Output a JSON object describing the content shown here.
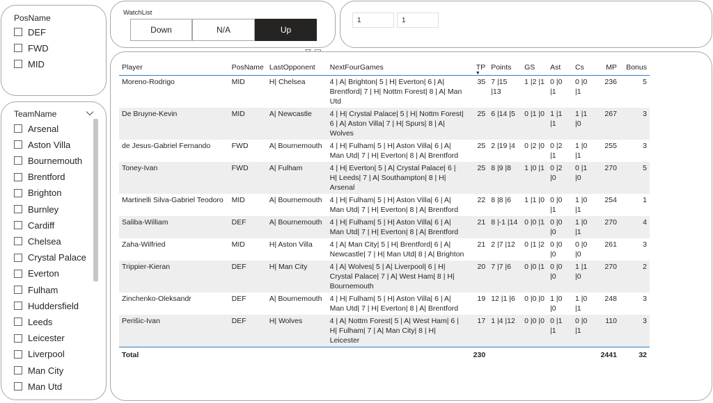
{
  "pos_slicer": {
    "title": "PosName",
    "items": [
      "DEF",
      "FWD",
      "MID"
    ]
  },
  "team_slicer": {
    "title": "TeamName",
    "items": [
      "Arsenal",
      "Aston Villa",
      "Bournemouth",
      "Brentford",
      "Brighton",
      "Burnley",
      "Cardiff",
      "Chelsea",
      "Crystal Palace",
      "Everton",
      "Fulham",
      "Huddersfield",
      "Leeds",
      "Leicester",
      "Liverpool",
      "Man City",
      "Man Utd"
    ]
  },
  "watchlist": {
    "title": "WatchList",
    "buttons": [
      "Down",
      "N/A",
      "Up"
    ],
    "selected": "Up"
  },
  "range_inputs": [
    "1",
    "1"
  ],
  "table": {
    "columns": [
      "Player",
      "PosName",
      "LastOpponent",
      "NextFourGames",
      "TP",
      "Points",
      "GS",
      "Ast",
      "Cs",
      "MP",
      "Bonus"
    ],
    "sorted_column": "TP",
    "rows": [
      [
        "Moreno-Rodrigo",
        "MID",
        "H| Chelsea",
        "4 | A| Brighton| 5 | H| Everton| 6 | A| Brentford| 7 | H| Nottm Forest| 8 | A| Man Utd",
        "35",
        "7 |15 |13",
        "1 |2 |1",
        "0 |0 |1",
        "0 |0 |1",
        "236",
        "5"
      ],
      [
        "De Bruyne-Kevin",
        "MID",
        "A| Newcastle",
        "4 | H| Crystal Palace| 5 | H| Nottm Forest| 6 | A| Aston Villa| 7 | H| Spurs| 8 | A| Wolves",
        "25",
        "6 |14 |5",
        "0 |1 |0",
        "1 |1 |1",
        "1 |1 |0",
        "267",
        "3"
      ],
      [
        "de Jesus-Gabriel Fernando",
        "FWD",
        "A| Bournemouth",
        "4 | H| Fulham| 5 | H| Aston Villa| 6 | A| Man Utd| 7 | H| Everton| 8 | A| Brentford",
        "25",
        "2 |19 |4",
        "0 |2 |0",
        "0 |2 |1",
        "1 |0 |1",
        "255",
        "3"
      ],
      [
        "Toney-Ivan",
        "FWD",
        "A| Fulham",
        "4 | H| Everton| 5 | A| Crystal Palace| 6 | H| Leeds| 7 | A| Southampton| 8 | H| Arsenal",
        "25",
        "8 |9 |8",
        "1 |0 |1",
        "0 |2 |0",
        "0 |1 |0",
        "270",
        "5"
      ],
      [
        "Martinelli Silva-Gabriel Teodoro",
        "MID",
        "A| Bournemouth",
        "4 | H| Fulham| 5 | H| Aston Villa| 6 | A| Man Utd| 7 | H| Everton| 8 | A| Brentford",
        "22",
        "8 |8 |6",
        "1 |1 |0",
        "0 |0 |1",
        "1 |0 |1",
        "254",
        "1"
      ],
      [
        "Saliba-William",
        "DEF",
        "A| Bournemouth",
        "4 | H| Fulham| 5 | H| Aston Villa| 6 | A| Man Utd| 7 | H| Everton| 8 | A| Brentford",
        "21",
        "8 |-1 |14",
        "0 |0 |1",
        "0 |0 |0",
        "1 |0 |1",
        "270",
        "4"
      ],
      [
        "Zaha-Wilfried",
        "MID",
        "H| Aston Villa",
        "4 | A| Man City| 5 | H| Brentford| 6 | A| Newcastle| 7 | H| Man Utd| 8 | A| Brighton",
        "21",
        "2 |7 |12",
        "0 |1 |2",
        "0 |0 |0",
        "0 |0 |0",
        "261",
        "3"
      ],
      [
        "Trippier-Kieran",
        "DEF",
        "H| Man City",
        "4 | A| Wolves| 5 | A| Liverpool| 6 | H| Crystal Palace| 7 | A| West Ham| 8 | H| Bournemouth",
        "20",
        "7 |7 |6",
        "0 |0 |1",
        "0 |0 |0",
        "1 |1 |0",
        "270",
        "2"
      ],
      [
        "Zinchenko-Oleksandr",
        "DEF",
        "A| Bournemouth",
        "4 | H| Fulham| 5 | H| Aston Villa| 6 | A| Man Utd| 7 | H| Everton| 8 | A| Brentford",
        "19",
        "12 |1 |6",
        "0 |0 |0",
        "1 |0 |0",
        "1 |0 |1",
        "248",
        "3"
      ],
      [
        "Perišic-Ivan",
        "DEF",
        "H| Wolves",
        "4 | A| Nottm Forest| 5 | A| West Ham| 6 | H| Fulham| 7 | A| Man City| 8 | H| Leicester",
        "17",
        "1 |4 |12",
        "0 |0 |0",
        "0 |1 |1",
        "0 |0 |1",
        "110",
        "3"
      ]
    ],
    "totals": [
      "Total",
      "",
      "",
      "",
      "230",
      "",
      "",
      "",
      "",
      "2441",
      "32"
    ]
  },
  "icons": {
    "sort": "sort-descending-icon",
    "chevron": "chevron-down-icon",
    "filter": "filter-icon",
    "focus": "focus-mode-icon",
    "more": "more-options-icon"
  },
  "colors": {
    "accent": "#2f7ec4",
    "selected_button": "#252423",
    "row_stripe": "#eeeeee",
    "border": "#a6a6a6"
  }
}
